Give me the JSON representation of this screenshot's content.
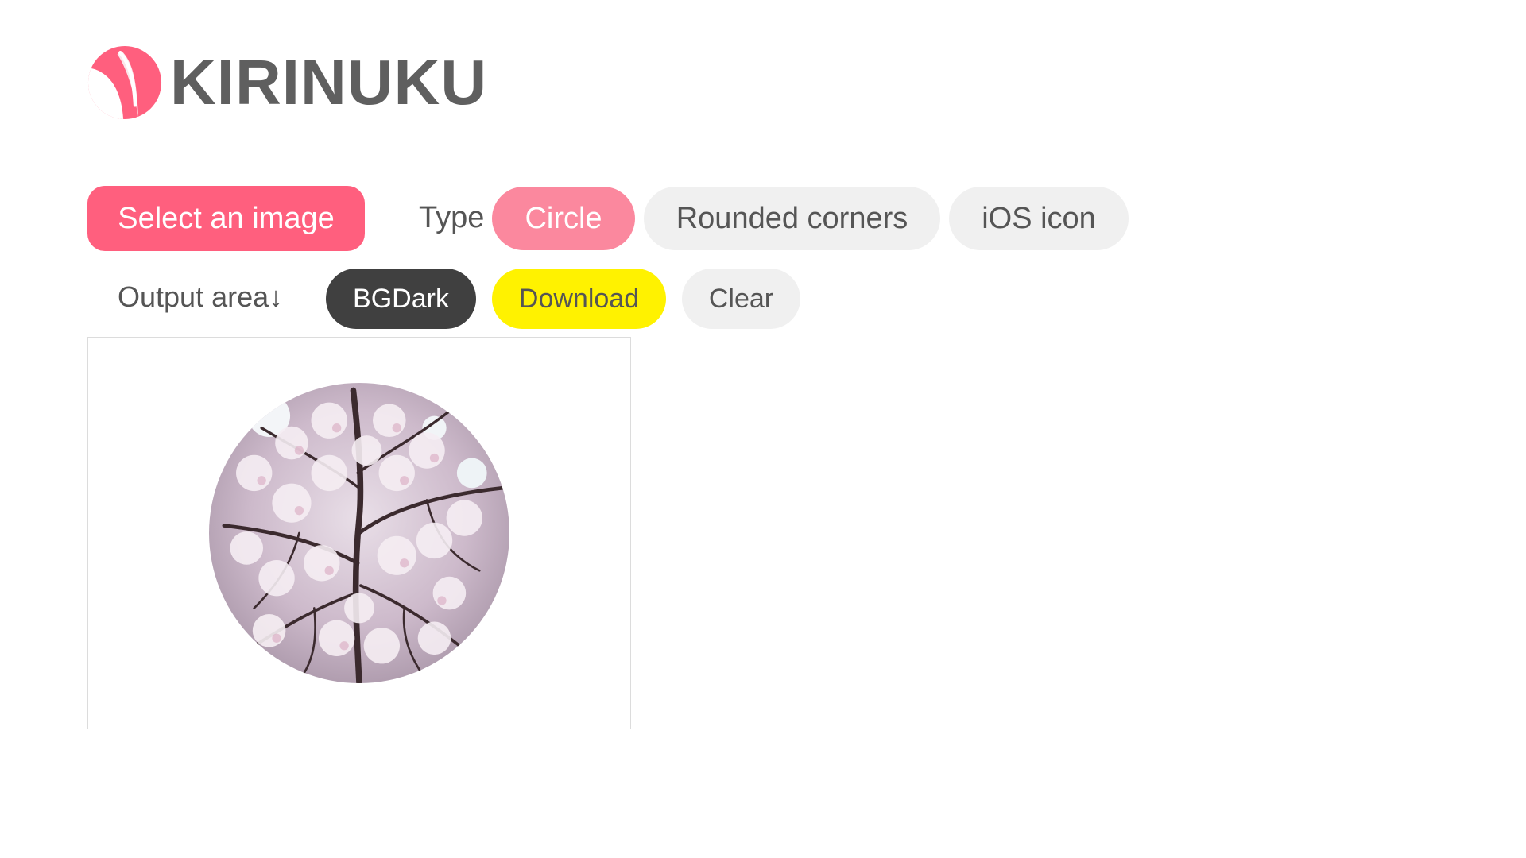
{
  "app": {
    "title": "KIRINUKU",
    "logo_icon": "kirinuku-logo-icon",
    "accent_color": "#ff5f7e"
  },
  "toolbar": {
    "select_label": "Select an image",
    "type_label": "Type",
    "types": [
      {
        "label": "Circle",
        "selected": true
      },
      {
        "label": "Rounded corners",
        "selected": false
      },
      {
        "label": "iOS icon",
        "selected": false
      }
    ]
  },
  "output": {
    "label": "Output area↓",
    "bgdark_label": "BGDark",
    "download_label": "Download",
    "clear_label": "Clear",
    "preview_icon": "cherry-blossom-circle-image",
    "preview_shape": "circle"
  },
  "colors": {
    "select_button": "#ff5f7e",
    "selected_type": "#fb889e",
    "inactive_button": "#f0f0f0",
    "bgdark_button": "#404040",
    "download_button": "#fff200",
    "text": "#555555"
  }
}
